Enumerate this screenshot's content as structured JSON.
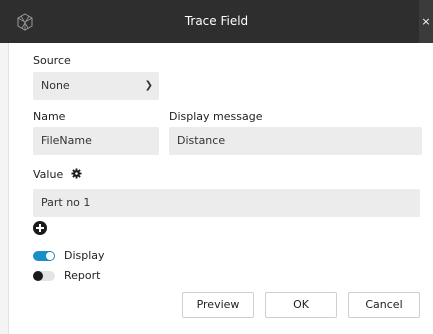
{
  "dialog": {
    "title": "Trace Field",
    "close_label": "×"
  },
  "source": {
    "label": "Source",
    "value": "None"
  },
  "name": {
    "label": "Name",
    "value": "FileName"
  },
  "display_message": {
    "label": "Display message",
    "value": "Distance"
  },
  "value": {
    "label": "Value",
    "field": "Part no 1"
  },
  "toggles": {
    "display": {
      "label": "Display",
      "on": true
    },
    "report": {
      "label": "Report",
      "on": false
    }
  },
  "buttons": {
    "preview": "Preview",
    "ok": "OK",
    "cancel": "Cancel"
  },
  "colors": {
    "titlebar": "#2e2e2e",
    "accent": "#1a8fc6",
    "field_bg": "#ececec"
  }
}
